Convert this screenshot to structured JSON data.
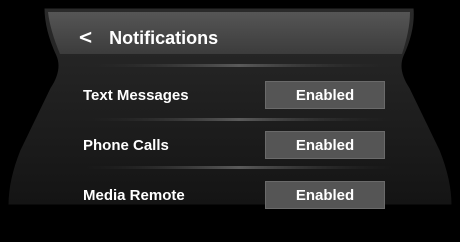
{
  "header": {
    "back_icon": "chevron-left-icon",
    "back_glyph": "<",
    "title": "Notifications"
  },
  "settings": [
    {
      "label": "Text Messages",
      "value": "Enabled"
    },
    {
      "label": "Phone Calls",
      "value": "Enabled"
    },
    {
      "label": "Media Remote",
      "value": "Enabled"
    }
  ],
  "colors": {
    "background": "#000000",
    "panel": "#1c1c1c",
    "header": "#4a4a4a",
    "toggle": "#555555",
    "text": "#ffffff"
  }
}
